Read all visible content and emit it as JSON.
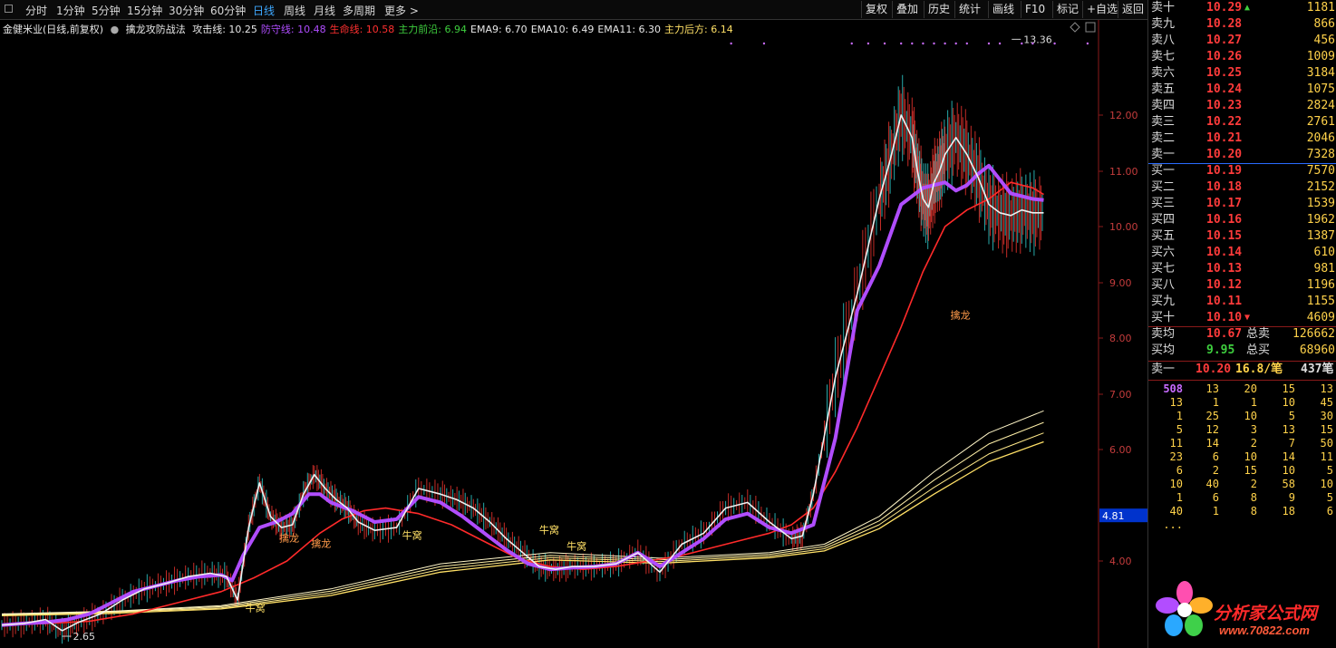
{
  "toolbar": {
    "periods": [
      "分时",
      "1分钟",
      "5分钟",
      "15分钟",
      "30分钟",
      "60分钟",
      "日线",
      "周线",
      "月线",
      "多周期",
      "更多 >"
    ],
    "active_period": "日线",
    "right_buttons": [
      "复权",
      "叠加",
      "历史",
      "统计",
      "画线",
      "F10",
      "标记",
      "+自选",
      "返回"
    ]
  },
  "legend": {
    "stock": "金健米业(日线,前复权)",
    "formula": "擒龙攻防战法",
    "items": [
      {
        "label": "攻击线: 10.25",
        "color": "#e8e8e8"
      },
      {
        "label": "防守线: 10.48",
        "color": "#b04dff"
      },
      {
        "label": "生命线: 10.58",
        "color": "#ff3030"
      },
      {
        "label": "主力前沿: 6.94",
        "color": "#3ecf3e"
      },
      {
        "label": "EMA9: 6.70",
        "color": "#e8e8e8"
      },
      {
        "label": "EMA10: 6.49",
        "color": "#e8e8e8"
      },
      {
        "label": "EMA11: 6.30",
        "color": "#e8e8e8"
      },
      {
        "label": "主力后方: 6.14",
        "color": "#ffe066"
      }
    ]
  },
  "chart_data": {
    "type": "line",
    "title": "金健米业(日线,前复权)",
    "y_ticks": [
      "12.00",
      "11.00",
      "10.00",
      "9.00",
      "8.00",
      "7.00",
      "6.00",
      "4.00"
    ],
    "y_tick_values": [
      12,
      11,
      10,
      9,
      8,
      7,
      6,
      4
    ],
    "ylim": [
      2.6,
      13.6
    ],
    "current_price_label": "4.81",
    "high_label": "13.36",
    "low_label": "2.65",
    "annotations": [
      {
        "text": "擒龙",
        "x": 0.253,
        "y": 4.35
      },
      {
        "text": "擒龙",
        "x": 0.282,
        "y": 4.25
      },
      {
        "text": "擒龙",
        "x": 0.865,
        "y": 8.35
      },
      {
        "text": "牛窝",
        "x": 0.222,
        "y": 3.1
      },
      {
        "text": "牛窝",
        "x": 0.365,
        "y": 4.4
      },
      {
        "text": "牛窝",
        "x": 0.49,
        "y": 4.5
      },
      {
        "text": "牛窝",
        "x": 0.515,
        "y": 4.2
      }
    ],
    "series": [
      {
        "name": "攻击线",
        "color": "#f0f0f0",
        "width": 1.6,
        "x": [
          0,
          0.02,
          0.04,
          0.055,
          0.07,
          0.09,
          0.11,
          0.13,
          0.15,
          0.17,
          0.19,
          0.205,
          0.215,
          0.225,
          0.235,
          0.245,
          0.255,
          0.265,
          0.275,
          0.285,
          0.295,
          0.305,
          0.315,
          0.325,
          0.34,
          0.36,
          0.38,
          0.4,
          0.415,
          0.43,
          0.445,
          0.46,
          0.475,
          0.49,
          0.505,
          0.52,
          0.54,
          0.56,
          0.58,
          0.6,
          0.62,
          0.64,
          0.66,
          0.68,
          0.7,
          0.72,
          0.73,
          0.74,
          0.76,
          0.78,
          0.8,
          0.81,
          0.82,
          0.83,
          0.835,
          0.84,
          0.845,
          0.85,
          0.855,
          0.86,
          0.87,
          0.88,
          0.89,
          0.9,
          0.91,
          0.92,
          0.93,
          0.94,
          0.95
        ],
        "y": [
          2.85,
          2.88,
          2.95,
          2.75,
          2.9,
          3.05,
          3.3,
          3.5,
          3.6,
          3.72,
          3.78,
          3.72,
          3.3,
          4.6,
          5.4,
          4.8,
          4.6,
          4.65,
          5.2,
          5.55,
          5.3,
          5.1,
          4.95,
          4.7,
          4.55,
          4.6,
          5.3,
          5.2,
          5.1,
          4.95,
          4.7,
          4.4,
          4.15,
          3.9,
          3.85,
          3.9,
          3.9,
          3.95,
          4.15,
          3.8,
          4.3,
          4.5,
          4.95,
          5.05,
          4.7,
          4.4,
          4.45,
          5.2,
          7.3,
          8.8,
          10.5,
          11.2,
          12.0,
          11.6,
          11.0,
          10.5,
          10.35,
          10.8,
          11.0,
          11.3,
          11.6,
          11.3,
          10.9,
          10.4,
          10.25,
          10.2,
          10.3,
          10.25,
          10.25
        ]
      },
      {
        "name": "防守线",
        "color": "#b04dff",
        "width": 4,
        "x": [
          0,
          0.02,
          0.04,
          0.06,
          0.08,
          0.1,
          0.12,
          0.14,
          0.16,
          0.18,
          0.2,
          0.21,
          0.22,
          0.235,
          0.25,
          0.265,
          0.28,
          0.29,
          0.3,
          0.32,
          0.34,
          0.36,
          0.38,
          0.4,
          0.42,
          0.44,
          0.46,
          0.48,
          0.5,
          0.52,
          0.54,
          0.56,
          0.58,
          0.6,
          0.62,
          0.64,
          0.66,
          0.68,
          0.7,
          0.72,
          0.74,
          0.76,
          0.78,
          0.8,
          0.82,
          0.84,
          0.86,
          0.87,
          0.88,
          0.89,
          0.9,
          0.91,
          0.92,
          0.93,
          0.94,
          0.95
        ],
        "y": [
          2.85,
          2.88,
          2.9,
          2.95,
          3.05,
          3.25,
          3.45,
          3.55,
          3.65,
          3.72,
          3.75,
          3.65,
          4.1,
          4.6,
          4.7,
          4.85,
          5.2,
          5.2,
          5.05,
          4.9,
          4.7,
          4.75,
          5.15,
          5.05,
          4.8,
          4.5,
          4.2,
          3.95,
          3.85,
          3.88,
          3.9,
          3.95,
          4.15,
          3.9,
          4.15,
          4.4,
          4.75,
          4.85,
          4.6,
          4.5,
          4.65,
          6.2,
          8.5,
          9.3,
          10.4,
          10.7,
          10.8,
          10.65,
          10.75,
          10.95,
          11.1,
          10.85,
          10.6,
          10.55,
          10.5,
          10.48
        ]
      },
      {
        "name": "生命线",
        "color": "#ff2a2a",
        "width": 1.6,
        "x": [
          0,
          0.04,
          0.08,
          0.12,
          0.16,
          0.2,
          0.23,
          0.26,
          0.29,
          0.31,
          0.33,
          0.35,
          0.38,
          0.41,
          0.44,
          0.47,
          0.5,
          0.53,
          0.56,
          0.59,
          0.62,
          0.65,
          0.68,
          0.7,
          0.72,
          0.74,
          0.76,
          0.78,
          0.8,
          0.82,
          0.84,
          0.86,
          0.88,
          0.9,
          0.92,
          0.94,
          0.95
        ],
        "y": [
          2.85,
          2.88,
          2.92,
          3.05,
          3.25,
          3.45,
          3.7,
          4.0,
          4.5,
          4.75,
          4.9,
          4.95,
          4.85,
          4.65,
          4.35,
          4.05,
          3.9,
          3.85,
          3.9,
          4.0,
          4.1,
          4.25,
          4.4,
          4.5,
          4.65,
          4.95,
          5.6,
          6.4,
          7.3,
          8.2,
          9.2,
          10.0,
          10.3,
          10.5,
          10.8,
          10.7,
          10.58
        ]
      },
      {
        "name": "EMA9",
        "color": "#fff6c8",
        "width": 1,
        "x": [
          0,
          0.1,
          0.2,
          0.3,
          0.4,
          0.5,
          0.6,
          0.7,
          0.75,
          0.8,
          0.85,
          0.9,
          0.95
        ],
        "y": [
          3.05,
          3.1,
          3.2,
          3.5,
          3.95,
          4.15,
          4.05,
          4.15,
          4.3,
          4.8,
          5.6,
          6.3,
          6.7
        ]
      },
      {
        "name": "EMA10",
        "color": "#fff0a8",
        "width": 1,
        "x": [
          0,
          0.1,
          0.2,
          0.3,
          0.4,
          0.5,
          0.6,
          0.7,
          0.75,
          0.8,
          0.85,
          0.9,
          0.95
        ],
        "y": [
          3.04,
          3.09,
          3.18,
          3.46,
          3.9,
          4.1,
          4.02,
          4.12,
          4.26,
          4.72,
          5.45,
          6.1,
          6.49
        ]
      },
      {
        "name": "EMA11",
        "color": "#ffe98a",
        "width": 1,
        "x": [
          0,
          0.1,
          0.2,
          0.3,
          0.4,
          0.5,
          0.6,
          0.7,
          0.75,
          0.8,
          0.85,
          0.9,
          0.95
        ],
        "y": [
          3.03,
          3.08,
          3.16,
          3.42,
          3.85,
          4.06,
          3.99,
          4.09,
          4.22,
          4.65,
          5.32,
          5.92,
          6.3
        ]
      },
      {
        "name": "主力后方",
        "color": "#ffe066",
        "width": 1.3,
        "x": [
          0,
          0.1,
          0.2,
          0.3,
          0.4,
          0.5,
          0.6,
          0.7,
          0.75,
          0.8,
          0.85,
          0.9,
          0.95
        ],
        "y": [
          3.02,
          3.06,
          3.14,
          3.38,
          3.8,
          4.02,
          3.96,
          4.06,
          4.18,
          4.58,
          5.2,
          5.78,
          6.14
        ]
      }
    ]
  },
  "quotes": {
    "asks": [
      {
        "label": "卖十",
        "price": "10.29",
        "vol": "1181"
      },
      {
        "label": "卖九",
        "price": "10.28",
        "vol": "866"
      },
      {
        "label": "卖八",
        "price": "10.27",
        "vol": "456"
      },
      {
        "label": "卖七",
        "price": "10.26",
        "vol": "1009"
      },
      {
        "label": "卖六",
        "price": "10.25",
        "vol": "3184"
      },
      {
        "label": "卖五",
        "price": "10.24",
        "vol": "1075"
      },
      {
        "label": "卖四",
        "price": "10.23",
        "vol": "2824"
      },
      {
        "label": "卖三",
        "price": "10.22",
        "vol": "2761"
      },
      {
        "label": "卖二",
        "price": "10.21",
        "vol": "2046"
      },
      {
        "label": "卖一",
        "price": "10.20",
        "vol": "7328"
      }
    ],
    "bids": [
      {
        "label": "买一",
        "price": "10.19",
        "vol": "7570"
      },
      {
        "label": "买二",
        "price": "10.18",
        "vol": "2152"
      },
      {
        "label": "买三",
        "price": "10.17",
        "vol": "1539"
      },
      {
        "label": "买四",
        "price": "10.16",
        "vol": "1962"
      },
      {
        "label": "买五",
        "price": "10.15",
        "vol": "1387"
      },
      {
        "label": "买六",
        "price": "10.14",
        "vol": "610"
      },
      {
        "label": "买七",
        "price": "10.13",
        "vol": "981"
      },
      {
        "label": "买八",
        "price": "10.12",
        "vol": "1196"
      },
      {
        "label": "买九",
        "price": "10.11",
        "vol": "1155"
      },
      {
        "label": "买十",
        "price": "10.10",
        "vol": "4609"
      }
    ],
    "ask_avg": {
      "label": "卖均",
      "price": "10.67",
      "total_label": "总卖",
      "total": "126662"
    },
    "bid_avg": {
      "label": "买均",
      "price": "9.95",
      "total_label": "总买",
      "total": "68960"
    },
    "sell1_detail": {
      "label": "卖一",
      "price": "10.20",
      "per": "16.8/笔",
      "count": "437笔"
    },
    "ticks": [
      [
        "508",
        "13",
        "20",
        "15",
        "13"
      ],
      [
        "13",
        "1",
        "1",
        "10",
        "45"
      ],
      [
        "1",
        "25",
        "10",
        "5",
        "30"
      ],
      [
        "5",
        "12",
        "3",
        "13",
        "15"
      ],
      [
        "11",
        "14",
        "2",
        "7",
        "50"
      ],
      [
        "23",
        "6",
        "10",
        "14",
        "11"
      ],
      [
        "6",
        "2",
        "15",
        "10",
        "5"
      ],
      [
        "10",
        "40",
        "2",
        "58",
        "10"
      ],
      [
        "1",
        "6",
        "8",
        "9",
        "5"
      ],
      [
        "40",
        "1",
        "8",
        "18",
        "6"
      ],
      [
        "...",
        "",
        "",
        "",
        ""
      ]
    ]
  },
  "logo": {
    "text": "分析家公式网",
    "url": "www.70822.com"
  }
}
